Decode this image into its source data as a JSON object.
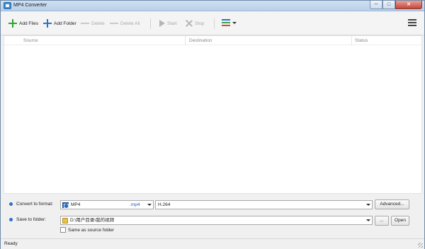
{
  "window": {
    "title": "MP4 Converter",
    "minimize": "─",
    "maximize": "□",
    "close": "✕"
  },
  "toolbar": {
    "add_files": "Add Files",
    "add_folder": "Add Folder",
    "delete": "Delete",
    "delete_all": "Delete All",
    "start": "Start",
    "stop": "Stop",
    "colors": {
      "green_plus": "#2aa52a",
      "blue_plus": "#2f6fd0",
      "theme_bars": [
        "#2f6fd0",
        "#35a845",
        "#e0433a"
      ]
    }
  },
  "list": {
    "columns": [
      "Source",
      "Destination",
      "Status"
    ],
    "rows": []
  },
  "output": {
    "format_label": "Convert to format:",
    "format_value": "MP4",
    "format_ext": ".mp4",
    "codec_value": "H.264",
    "advanced_button": "Advanced...",
    "folder_label": "Save to folder:",
    "folder_value": "D:\\用户目录\\我的视频",
    "browse_button": "...",
    "open_button": "Open",
    "same_as_source_label": "Same as source folder",
    "same_as_source_checked": false
  },
  "status": {
    "text": "Ready"
  }
}
